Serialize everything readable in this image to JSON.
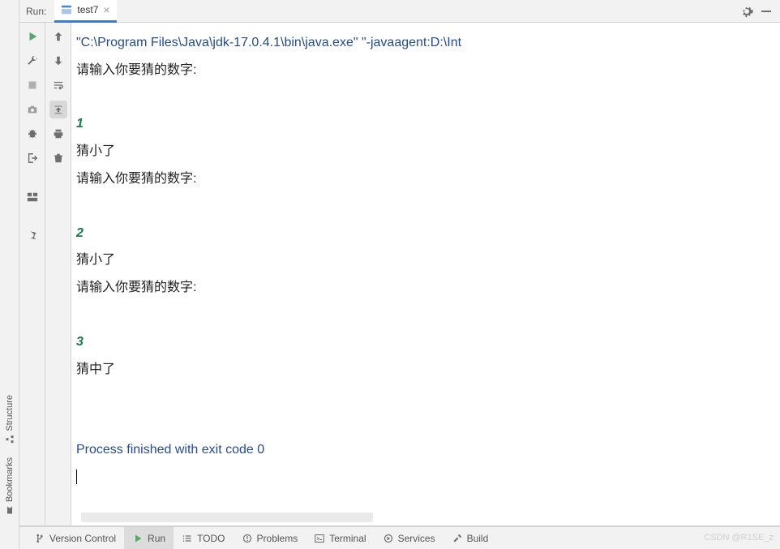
{
  "header": {
    "panel_label": "Run:",
    "tab_name": "test7"
  },
  "left_rail": {
    "structure": "Structure",
    "bookmarks": "Bookmarks"
  },
  "console": {
    "cmd_path": "\"C:\\Program Files\\Java\\jdk-17.0.4.1\\bin\\java.exe\" \"-javaagent:D:\\Int",
    "prompt": "请输入你要猜的数字:",
    "attempts": [
      {
        "n": "1",
        "result": "猜小了"
      },
      {
        "n": "2",
        "result": "猜小了"
      },
      {
        "n": "3",
        "result": "猜中了"
      }
    ],
    "exit_line": "Process finished with exit code 0"
  },
  "bottom": {
    "vcs": "Version Control",
    "run": "Run",
    "todo": "TODO",
    "problems": "Problems",
    "terminal": "Terminal",
    "services": "Services",
    "build": "Build"
  },
  "watermark": "CSDN @R1SE_z"
}
